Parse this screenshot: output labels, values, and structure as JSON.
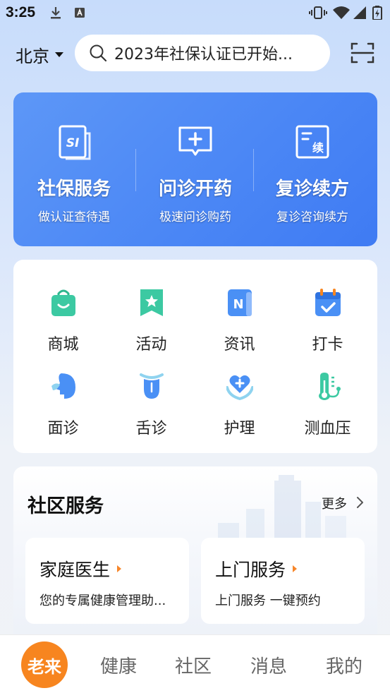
{
  "status_bar": {
    "time": "3:25",
    "icons": [
      "download-icon",
      "text-a-icon",
      "vibrate-icon",
      "wifi-icon",
      "signal-icon",
      "battery-icon"
    ]
  },
  "header": {
    "city": "北京",
    "search_placeholder": "2023年社保认证已开始...",
    "icons": {
      "search": "search-icon",
      "scan": "scan-icon"
    }
  },
  "hero_services": [
    {
      "title": "社保服务",
      "subtitle": "做认证查待遇",
      "icon": "social-security-icon"
    },
    {
      "title": "问诊开药",
      "subtitle": "极速问诊购药",
      "icon": "consult-plus-icon"
    },
    {
      "title": "复诊续方",
      "subtitle": "复诊咨询续方",
      "icon": "prescription-renew-icon"
    }
  ],
  "grid": [
    {
      "label": "商城",
      "icon": "shopping-bag-icon",
      "color": "#3cc9a2"
    },
    {
      "label": "活动",
      "icon": "star-bookmark-icon",
      "color": "#3cc9a2"
    },
    {
      "label": "资讯",
      "icon": "news-icon",
      "color": "#4a90f5"
    },
    {
      "label": "打卡",
      "icon": "calendar-check-icon",
      "color": "#4a90f5"
    },
    {
      "label": "面诊",
      "icon": "face-profile-icon",
      "color": "#4a90f5"
    },
    {
      "label": "舌诊",
      "icon": "tongue-icon",
      "color": "#4a90f5"
    },
    {
      "label": "护理",
      "icon": "heart-care-icon",
      "color": "#4a90f5"
    },
    {
      "label": "测血压",
      "icon": "blood-pressure-icon",
      "color": "#3cc9a2"
    }
  ],
  "community": {
    "title": "社区服务",
    "more": "更多",
    "cards": [
      {
        "title": "家庭医生",
        "subtitle": "您的专属健康管理助..."
      },
      {
        "title": "上门服务",
        "subtitle": "上门服务 一键预约"
      }
    ]
  },
  "bottom_nav": {
    "logo": "老来",
    "items": [
      "健康",
      "社区",
      "消息",
      "我的"
    ]
  },
  "colors": {
    "accent": "#4a86f5",
    "orange": "#f7851f",
    "green": "#3cc9a2"
  }
}
